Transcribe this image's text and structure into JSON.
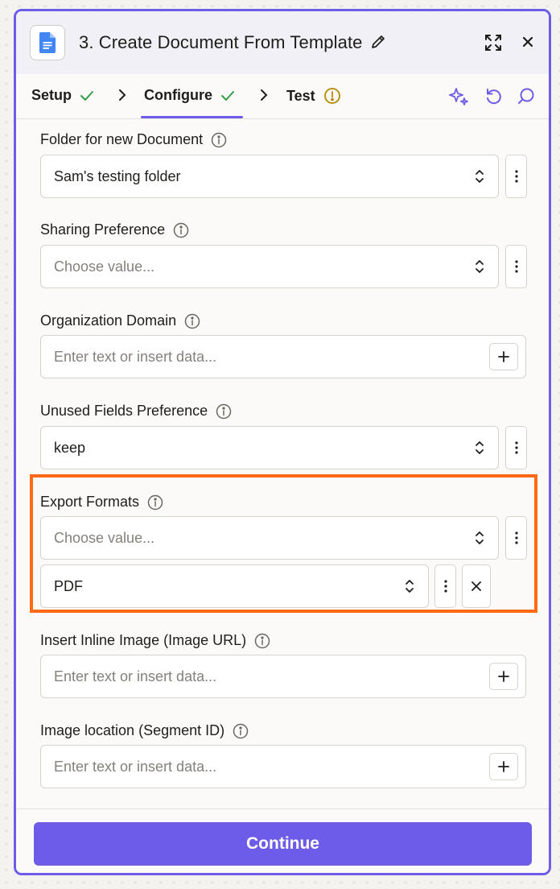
{
  "header": {
    "title": "3. Create Document From Template",
    "app_icon": "google-docs-icon"
  },
  "tabs": [
    {
      "label": "Setup",
      "status": "complete"
    },
    {
      "label": "Configure",
      "status": "complete",
      "active": true
    },
    {
      "label": "Test",
      "status": "warning"
    }
  ],
  "fields": {
    "folder": {
      "label": "Folder for new Document",
      "value": "Sam's testing folder"
    },
    "sharing": {
      "label": "Sharing Preference",
      "placeholder": "Choose value..."
    },
    "domain": {
      "label": "Organization Domain",
      "placeholder": "Enter text or insert data..."
    },
    "unused": {
      "label": "Unused Fields Preference",
      "value": "keep"
    },
    "export": {
      "label": "Export Formats",
      "placeholder": "Choose value...",
      "items": [
        "PDF"
      ]
    },
    "inline_image": {
      "label": "Insert Inline Image (Image URL)",
      "placeholder": "Enter text or insert data..."
    },
    "image_location": {
      "label": "Image location (Segment ID)",
      "placeholder": "Enter text or insert data..."
    }
  },
  "footer": {
    "continue_label": "Continue"
  },
  "colors": {
    "accent": "#6c5ce7",
    "highlight": "#ff6a13",
    "success": "#2f9e44",
    "warning": "#b58a00"
  }
}
